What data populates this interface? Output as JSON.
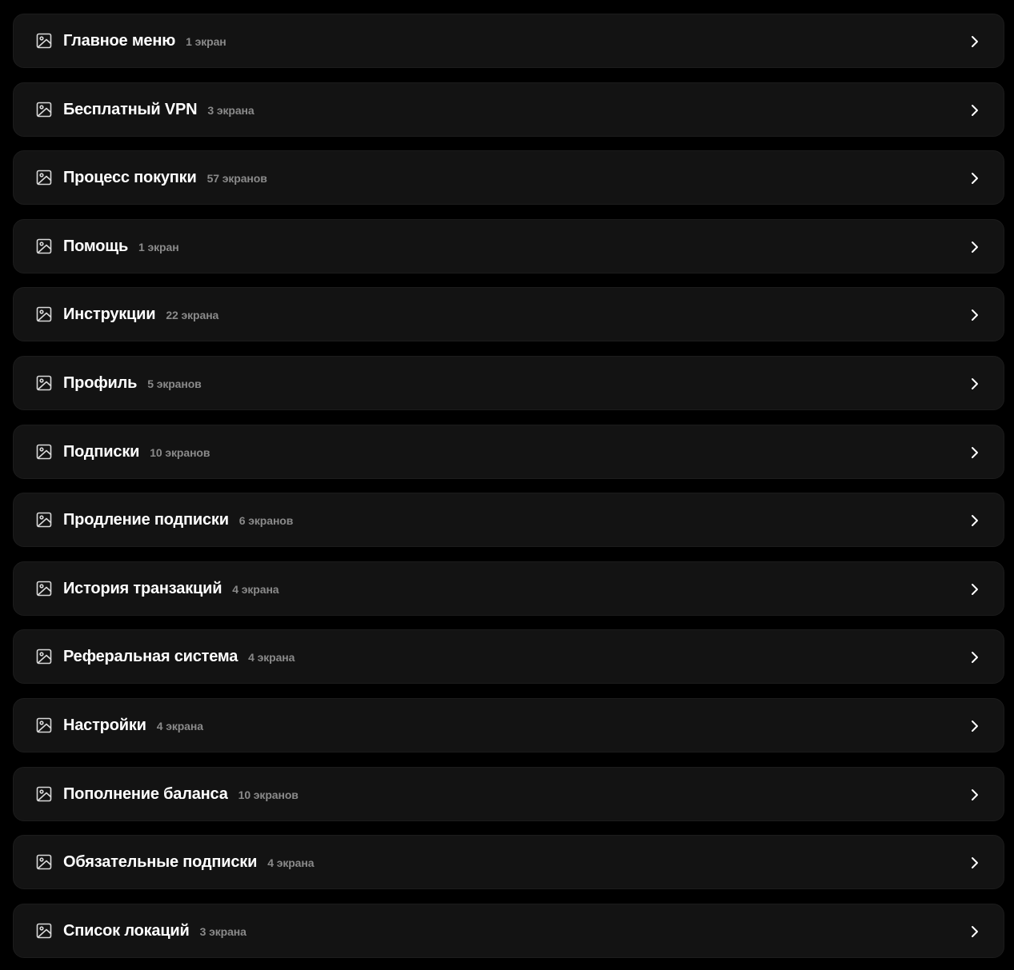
{
  "colors": {
    "background": "#000000",
    "card": "#131313",
    "title": "#ffffff",
    "count": "#8a8a8a",
    "icon": "#d9d9d9"
  },
  "items": [
    {
      "title": "Главное меню",
      "count": "1 экран",
      "icon": "image-icon"
    },
    {
      "title": "Бесплатный VPN",
      "count": "3 экрана",
      "icon": "image-icon"
    },
    {
      "title": "Процесс покупки",
      "count": "57 экранов",
      "icon": "image-icon"
    },
    {
      "title": "Помощь",
      "count": "1 экран",
      "icon": "image-icon"
    },
    {
      "title": "Инструкции",
      "count": "22 экрана",
      "icon": "image-icon"
    },
    {
      "title": "Профиль",
      "count": "5 экранов",
      "icon": "image-icon"
    },
    {
      "title": "Подписки",
      "count": "10 экранов",
      "icon": "image-icon"
    },
    {
      "title": "Продление подписки",
      "count": "6 экранов",
      "icon": "image-icon"
    },
    {
      "title": "История транзакций",
      "count": "4 экрана",
      "icon": "image-icon"
    },
    {
      "title": "Реферальная система",
      "count": "4 экрана",
      "icon": "image-icon"
    },
    {
      "title": "Настройки",
      "count": "4 экрана",
      "icon": "image-icon"
    },
    {
      "title": "Пополнение баланса",
      "count": "10 экранов",
      "icon": "image-icon"
    },
    {
      "title": "Обязательные подписки",
      "count": "4 экрана",
      "icon": "image-icon"
    },
    {
      "title": "Список локаций",
      "count": "3 экрана",
      "icon": "image-icon"
    }
  ]
}
